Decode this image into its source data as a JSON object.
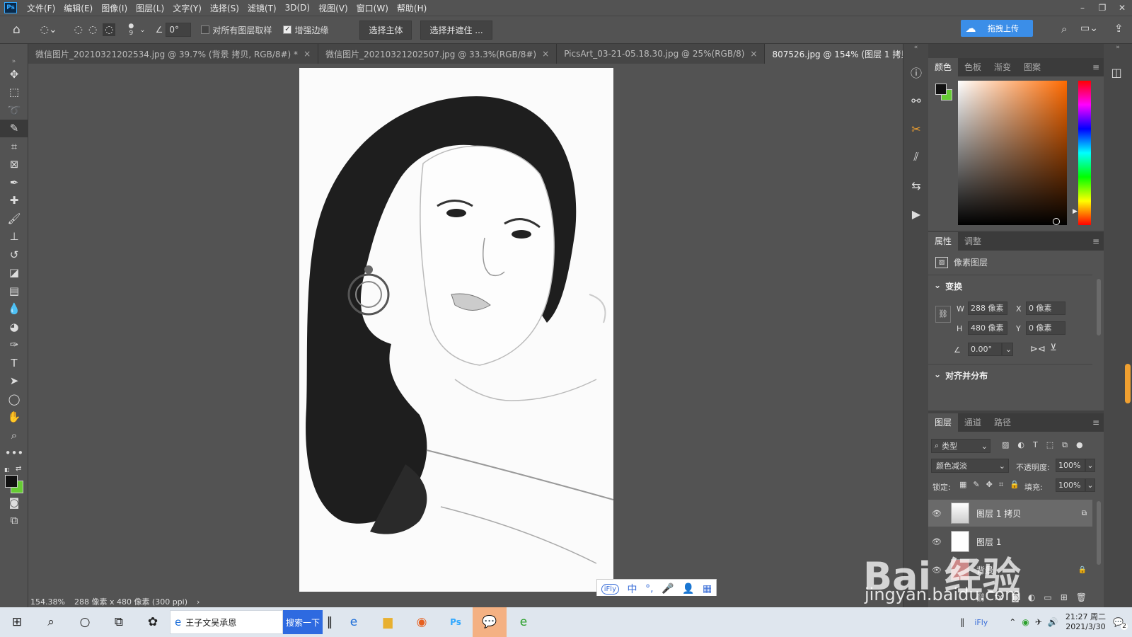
{
  "app": {
    "logo": "Ps"
  },
  "menu": [
    "文件(F)",
    "编辑(E)",
    "图像(I)",
    "图层(L)",
    "文字(Y)",
    "选择(S)",
    "滤镜(T)",
    "3D(D)",
    "视图(V)",
    "窗口(W)",
    "帮助(H)"
  ],
  "options": {
    "brush_size": "9",
    "angle": "0°",
    "sample_all_layers": "对所有图层取样",
    "enhance_edge": "增强边缘",
    "select_subject": "选择主体",
    "select_and_mask": "选择并遮住 ...",
    "upload": "拖拽上传"
  },
  "tabs": [
    {
      "label": "微信图片_20210321202534.jpg @ 39.7% (背景 拷贝, RGB/8#) *"
    },
    {
      "label": "微信图片_20210321202507.jpg @ 33.3%(RGB/8#)"
    },
    {
      "label": "PicsArt_03-21-05.18.30.jpg @ 25%(RGB/8)"
    },
    {
      "label": "807526.jpg @ 154% (图层 1 拷贝, RGB/8) *"
    }
  ],
  "status": {
    "zoom": "154.38%",
    "info": "288 像素 x 480 像素 (300 ppi)"
  },
  "ime": {
    "mode": "中"
  },
  "color_panel": {
    "tabs": [
      "颜色",
      "色板",
      "渐变",
      "图案"
    ],
    "fg": "#111111",
    "bg": "#66cc33",
    "hue": "#ff6a00"
  },
  "properties": {
    "tabs": [
      "属性",
      "调整"
    ],
    "kind": "像素图层",
    "transform_title": "变换",
    "w_label": "W",
    "w": "288 像素",
    "h_label": "H",
    "h": "480 像素",
    "x_label": "X",
    "x": "0 像素",
    "y_label": "Y",
    "y": "0 像素",
    "angle": "0.00°",
    "align_title": "对齐并分布"
  },
  "layers": {
    "tabs": [
      "图层",
      "通道",
      "路径"
    ],
    "filter": "类型",
    "blend": "颜色减淡",
    "opacity_label": "不透明度:",
    "opacity": "100%",
    "lock_label": "锁定:",
    "fill_label": "填充:",
    "fill": "100%",
    "items": [
      {
        "name": "图层 1 拷贝"
      },
      {
        "name": "图层 1"
      },
      {
        "name": "背景"
      }
    ]
  },
  "taskbar": {
    "search_text": "王子文吴承恩",
    "search_button": "搜索一下",
    "time": "21:27 周二",
    "date": "2021/3/30",
    "notify_count": "2"
  },
  "watermark": {
    "brand": "Bai  经验",
    "url": "jingyan.baidu.com"
  }
}
